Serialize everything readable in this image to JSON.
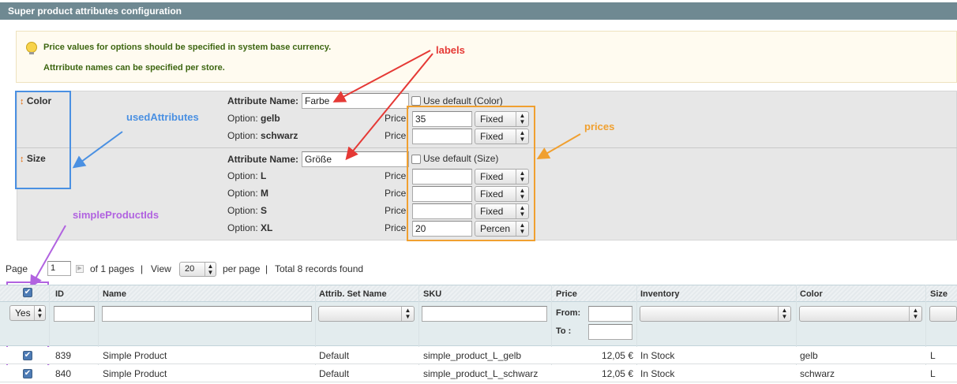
{
  "section_title": "Super product attributes configuration",
  "notice": {
    "line1": "Price values for options should be specified in system base currency.",
    "line2": "Attrribute names can be specified per store."
  },
  "attributes": {
    "name_label": "Attribute Name:",
    "option_prefix": "Option:",
    "price_label": "Price:",
    "color": {
      "title": "Color",
      "name_value": "Farbe",
      "use_default": "Use default (Color)",
      "options": [
        {
          "label": "gelb",
          "price": "35",
          "type": "Fixed"
        },
        {
          "label": "schwarz",
          "price": "",
          "type": "Fixed"
        }
      ]
    },
    "size": {
      "title": "Size",
      "name_value": "Größe",
      "use_default": "Use default (Size)",
      "options": [
        {
          "label": "L",
          "price": "",
          "type": "Fixed"
        },
        {
          "label": "M",
          "price": "",
          "type": "Fixed"
        },
        {
          "label": "S",
          "price": "",
          "type": "Fixed"
        },
        {
          "label": "XL",
          "price": "20",
          "type": "Percen"
        }
      ]
    }
  },
  "annotations": {
    "labels": "labels",
    "usedAttributes": "usedAttributes",
    "prices": "prices",
    "simpleProductIds": "simpleProductIds",
    "colors": {
      "labels": "#e53935",
      "usedAttributes": "#4a90e2",
      "prices": "#f0a030",
      "simpleProductIds": "#b163e0"
    }
  },
  "pager": {
    "page_label": "Page",
    "page_value": "1",
    "of_pages": "of 1 pages",
    "sep": "|",
    "view_label": "View",
    "view_value": "20",
    "per_page": "per page",
    "total": "Total 8 records found"
  },
  "grid": {
    "columns": [
      "ID",
      "Name",
      "Attrib. Set Name",
      "SKU",
      "Price",
      "Inventory",
      "Color",
      "Size"
    ],
    "filter": {
      "select_value": "Yes",
      "from_label": "From:",
      "to_label": "To :"
    },
    "rows": [
      {
        "id": "839",
        "name": "Simple Product",
        "set": "Default",
        "sku": "simple_product_L_gelb",
        "price": "12,05 €",
        "inventory": "In Stock",
        "color": "gelb",
        "size": "L"
      },
      {
        "id": "840",
        "name": "Simple Product",
        "set": "Default",
        "sku": "simple_product_L_schwarz",
        "price": "12,05 €",
        "inventory": "In Stock",
        "color": "schwarz",
        "size": "L"
      }
    ]
  }
}
